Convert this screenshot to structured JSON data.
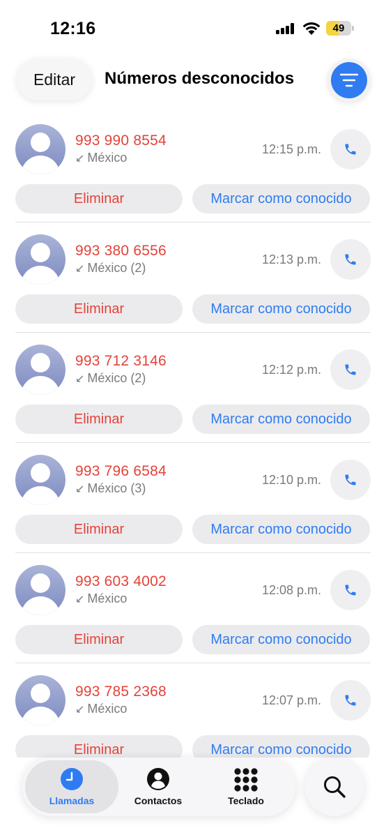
{
  "status_bar": {
    "time": "12:16",
    "battery_level": "49",
    "battery_fraction": 0.49,
    "icons": [
      "cellular-signal-icon",
      "wifi-icon",
      "battery-icon"
    ]
  },
  "header": {
    "edit_label": "Editar",
    "title": "Números desconocidos",
    "filter_icon": "filter-lines-icon"
  },
  "calls": [
    {
      "number": "993 990 8554",
      "location": "México",
      "time": "12:15 p.m."
    },
    {
      "number": "993 380 6556",
      "location": "México (2)",
      "time": "12:13 p.m."
    },
    {
      "number": "993 712 3146",
      "location": "México (2)",
      "time": "12:12 p.m."
    },
    {
      "number": "993 796 6584",
      "location": "México (3)",
      "time": "12:10 p.m."
    },
    {
      "number": "993 603 4002",
      "location": "México",
      "time": "12:08 p.m."
    },
    {
      "number": "993 785 2368",
      "location": "México",
      "time": "12:07 p.m."
    }
  ],
  "actions": {
    "delete_label": "Eliminar",
    "mark_known_label": "Marcar como conocido",
    "incoming_arrow": "↙"
  },
  "tab_bar": {
    "tabs": [
      {
        "label": "Llamadas",
        "icon": "clock-icon",
        "active": true
      },
      {
        "label": "Contactos",
        "icon": "contact-icon",
        "active": false
      },
      {
        "label": "Teclado",
        "icon": "keypad-icon",
        "active": false
      }
    ],
    "search_icon": "search-icon"
  },
  "colors": {
    "accent": "#2f7cf2",
    "missed_red": "#e5423a",
    "secondary_text": "#7a7a7e",
    "battery_yellow": "#f5d442"
  }
}
